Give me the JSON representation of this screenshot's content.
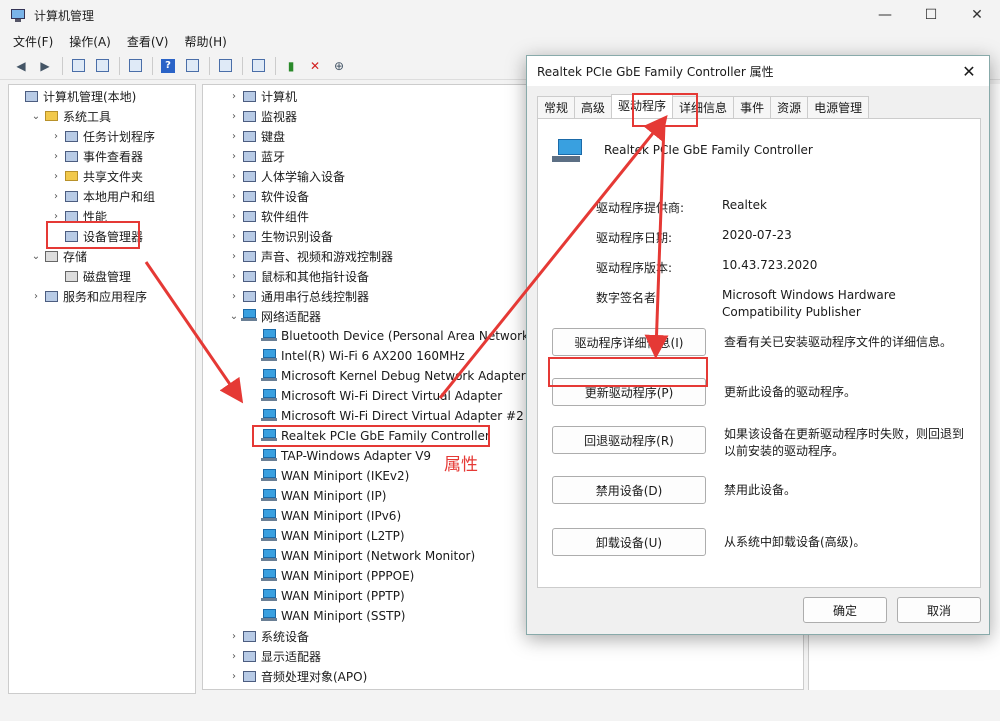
{
  "window": {
    "title": "计算机管理",
    "controls": [
      "—",
      "☐",
      "✕"
    ]
  },
  "menu": [
    "文件(F)",
    "操作(A)",
    "查看(V)",
    "帮助(H)"
  ],
  "left_tree": [
    {
      "label": "计算机管理(本地)",
      "indent": 0,
      "arrow": "",
      "icon": "computer-management-icon"
    },
    {
      "label": "系统工具",
      "indent": 1,
      "arrow": "⌄",
      "icon": "tools-icon"
    },
    {
      "label": "任务计划程序",
      "indent": 2,
      "arrow": "›",
      "icon": "clock-icon"
    },
    {
      "label": "事件查看器",
      "indent": 2,
      "arrow": "›",
      "icon": "event-viewer-icon"
    },
    {
      "label": "共享文件夹",
      "indent": 2,
      "arrow": "›",
      "icon": "shared-folder-icon"
    },
    {
      "label": "本地用户和组",
      "indent": 2,
      "arrow": "›",
      "icon": "users-icon"
    },
    {
      "label": "性能",
      "indent": 2,
      "arrow": "›",
      "icon": "performance-icon"
    },
    {
      "label": "设备管理器",
      "indent": 2,
      "arrow": "",
      "icon": "device-manager-icon"
    },
    {
      "label": "存储",
      "indent": 1,
      "arrow": "⌄",
      "icon": "storage-icon"
    },
    {
      "label": "磁盘管理",
      "indent": 2,
      "arrow": "",
      "icon": "disk-icon"
    },
    {
      "label": "服务和应用程序",
      "indent": 1,
      "arrow": "›",
      "icon": "services-icon"
    }
  ],
  "devices": [
    {
      "label": "计算机",
      "indent": 0,
      "arrow": "›",
      "icon": "computer-icon"
    },
    {
      "label": "监视器",
      "indent": 0,
      "arrow": "›",
      "icon": "monitor-icon"
    },
    {
      "label": "键盘",
      "indent": 0,
      "arrow": "›",
      "icon": "keyboard-icon"
    },
    {
      "label": "蓝牙",
      "indent": 0,
      "arrow": "›",
      "icon": "bluetooth-icon"
    },
    {
      "label": "人体学输入设备",
      "indent": 0,
      "arrow": "›",
      "icon": "hid-icon"
    },
    {
      "label": "软件设备",
      "indent": 0,
      "arrow": "›",
      "icon": "software-device-icon"
    },
    {
      "label": "软件组件",
      "indent": 0,
      "arrow": "›",
      "icon": "software-component-icon"
    },
    {
      "label": "生物识别设备",
      "indent": 0,
      "arrow": "›",
      "icon": "biometric-icon"
    },
    {
      "label": "声音、视频和游戏控制器",
      "indent": 0,
      "arrow": "›",
      "icon": "sound-icon"
    },
    {
      "label": "鼠标和其他指针设备",
      "indent": 0,
      "arrow": "›",
      "icon": "mouse-icon"
    },
    {
      "label": "通用串行总线控制器",
      "indent": 0,
      "arrow": "›",
      "icon": "usb-icon"
    },
    {
      "label": "网络适配器",
      "indent": 0,
      "arrow": "⌄",
      "icon": "network-icon"
    },
    {
      "label": "Bluetooth Device (Personal Area Network)",
      "indent": 1,
      "arrow": "",
      "icon": "network-adapter-icon"
    },
    {
      "label": "Intel(R) Wi-Fi 6 AX200 160MHz",
      "indent": 1,
      "arrow": "",
      "icon": "network-adapter-icon"
    },
    {
      "label": "Microsoft Kernel Debug Network Adapter",
      "indent": 1,
      "arrow": "",
      "icon": "network-adapter-icon"
    },
    {
      "label": "Microsoft Wi-Fi Direct Virtual Adapter",
      "indent": 1,
      "arrow": "",
      "icon": "network-adapter-icon"
    },
    {
      "label": "Microsoft Wi-Fi Direct Virtual Adapter #2",
      "indent": 1,
      "arrow": "",
      "icon": "network-adapter-icon"
    },
    {
      "label": "Realtek PCIe GbE Family Controller",
      "indent": 1,
      "arrow": "",
      "icon": "network-adapter-icon"
    },
    {
      "label": "TAP-Windows Adapter V9",
      "indent": 1,
      "arrow": "",
      "icon": "network-adapter-icon"
    },
    {
      "label": "WAN Miniport (IKEv2)",
      "indent": 1,
      "arrow": "",
      "icon": "network-adapter-icon"
    },
    {
      "label": "WAN Miniport (IP)",
      "indent": 1,
      "arrow": "",
      "icon": "network-adapter-icon"
    },
    {
      "label": "WAN Miniport (IPv6)",
      "indent": 1,
      "arrow": "",
      "icon": "network-adapter-icon"
    },
    {
      "label": "WAN Miniport (L2TP)",
      "indent": 1,
      "arrow": "",
      "icon": "network-adapter-icon"
    },
    {
      "label": "WAN Miniport (Network Monitor)",
      "indent": 1,
      "arrow": "",
      "icon": "network-adapter-icon"
    },
    {
      "label": "WAN Miniport (PPPOE)",
      "indent": 1,
      "arrow": "",
      "icon": "network-adapter-icon"
    },
    {
      "label": "WAN Miniport (PPTP)",
      "indent": 1,
      "arrow": "",
      "icon": "network-adapter-icon"
    },
    {
      "label": "WAN Miniport (SSTP)",
      "indent": 1,
      "arrow": "",
      "icon": "network-adapter-icon"
    },
    {
      "label": "系统设备",
      "indent": 0,
      "arrow": "›",
      "icon": "system-device-icon"
    },
    {
      "label": "显示适配器",
      "indent": 0,
      "arrow": "›",
      "icon": "display-adapter-icon"
    },
    {
      "label": "音频处理对象(APO)",
      "indent": 0,
      "arrow": "›",
      "icon": "audio-icon"
    }
  ],
  "annotation": {
    "label": "属性",
    "color": "#e53935"
  },
  "dialog": {
    "title": "Realtek PCIe GbE Family Controller 属性",
    "tabs": [
      "常规",
      "高级",
      "驱动程序",
      "详细信息",
      "事件",
      "资源",
      "电源管理"
    ],
    "active_tab": "驱动程序",
    "device_name": "Realtek PCIe GbE Family Controller",
    "fields": [
      {
        "key": "驱动程序提供商:",
        "value": "Realtek"
      },
      {
        "key": "驱动程序日期:",
        "value": "2020-07-23"
      },
      {
        "key": "驱动程序版本:",
        "value": "10.43.723.2020"
      },
      {
        "key": "数字签名者:",
        "value": "Microsoft Windows Hardware Compatibility Publisher"
      }
    ],
    "buttons": [
      {
        "label": "驱动程序详细信息(I)",
        "desc": "查看有关已安装驱动程序文件的详细信息。"
      },
      {
        "label": "更新驱动程序(P)",
        "desc": "更新此设备的驱动程序。"
      },
      {
        "label": "回退驱动程序(R)",
        "desc": "如果该设备在更新驱动程序时失败，则回退到以前安装的驱动程序。"
      },
      {
        "label": "禁用设备(D)",
        "desc": "禁用此设备。"
      },
      {
        "label": "卸载设备(U)",
        "desc": "从系统中卸载设备(高级)。"
      }
    ],
    "ok": "确定",
    "cancel": "取消"
  }
}
